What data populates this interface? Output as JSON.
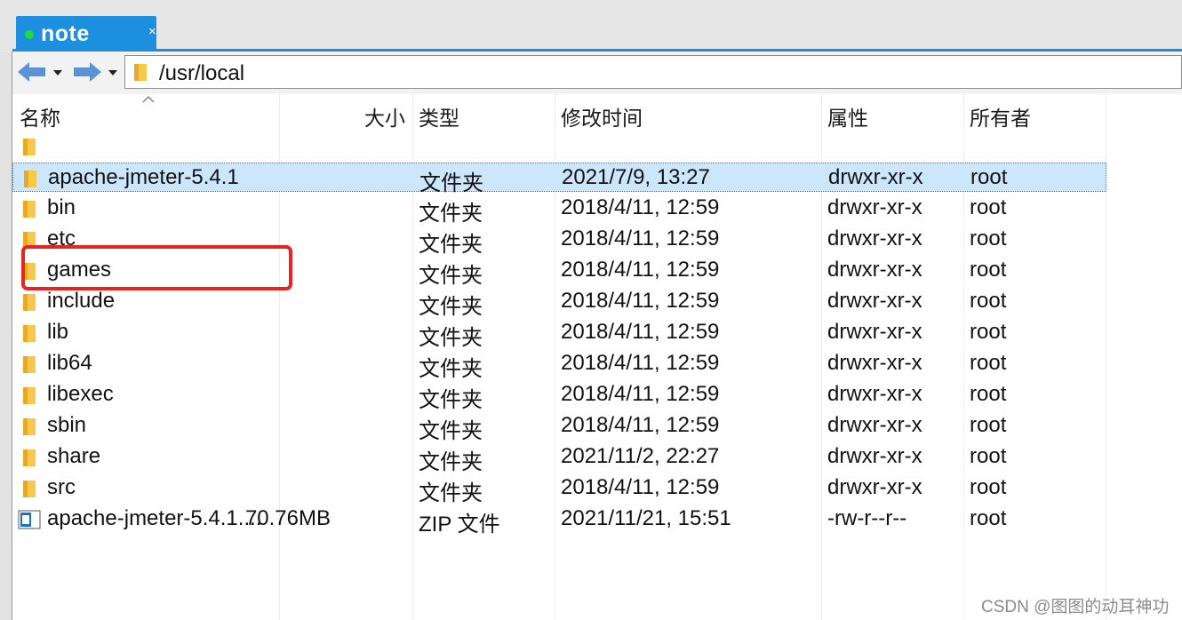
{
  "tab": {
    "title": "note",
    "close_glyph": "×",
    "status_color": "#1ddc3a",
    "accent": "#1c8fde"
  },
  "toolbar": {
    "back_icon": "arrow-left-icon",
    "forward_icon": "arrow-right-icon",
    "dropdown_icon": "caret-down-icon",
    "path": "/usr/local"
  },
  "columns": {
    "name": "名称",
    "size": "大小",
    "type": "类型",
    "modified": "修改时间",
    "attributes": "属性",
    "owner": "所有者",
    "sort_icon": "sort-ascending-icon"
  },
  "files": [
    {
      "name": "",
      "size": "",
      "type": "",
      "modified": "",
      "attributes": "",
      "owner": "",
      "icon": "folder-icon",
      "selected": false
    },
    {
      "name": "apache-jmeter-5.4.1",
      "size": "",
      "type": "文件夹",
      "modified": "2021/7/9, 13:27",
      "attributes": "drwxr-xr-x",
      "owner": "root",
      "icon": "folder-icon",
      "selected": true
    },
    {
      "name": "bin",
      "size": "",
      "type": "文件夹",
      "modified": "2018/4/11, 12:59",
      "attributes": "drwxr-xr-x",
      "owner": "root",
      "icon": "folder-icon",
      "selected": false
    },
    {
      "name": "etc",
      "size": "",
      "type": "文件夹",
      "modified": "2018/4/11, 12:59",
      "attributes": "drwxr-xr-x",
      "owner": "root",
      "icon": "folder-icon",
      "selected": false
    },
    {
      "name": "games",
      "size": "",
      "type": "文件夹",
      "modified": "2018/4/11, 12:59",
      "attributes": "drwxr-xr-x",
      "owner": "root",
      "icon": "folder-icon",
      "selected": false
    },
    {
      "name": "include",
      "size": "",
      "type": "文件夹",
      "modified": "2018/4/11, 12:59",
      "attributes": "drwxr-xr-x",
      "owner": "root",
      "icon": "folder-icon",
      "selected": false
    },
    {
      "name": "lib",
      "size": "",
      "type": "文件夹",
      "modified": "2018/4/11, 12:59",
      "attributes": "drwxr-xr-x",
      "owner": "root",
      "icon": "folder-icon",
      "selected": false
    },
    {
      "name": "lib64",
      "size": "",
      "type": "文件夹",
      "modified": "2018/4/11, 12:59",
      "attributes": "drwxr-xr-x",
      "owner": "root",
      "icon": "folder-icon",
      "selected": false
    },
    {
      "name": "libexec",
      "size": "",
      "type": "文件夹",
      "modified": "2018/4/11, 12:59",
      "attributes": "drwxr-xr-x",
      "owner": "root",
      "icon": "folder-icon",
      "selected": false
    },
    {
      "name": "sbin",
      "size": "",
      "type": "文件夹",
      "modified": "2018/4/11, 12:59",
      "attributes": "drwxr-xr-x",
      "owner": "root",
      "icon": "folder-icon",
      "selected": false
    },
    {
      "name": "share",
      "size": "",
      "type": "文件夹",
      "modified": "2021/11/2, 22:27",
      "attributes": "drwxr-xr-x",
      "owner": "root",
      "icon": "folder-icon",
      "selected": false
    },
    {
      "name": "src",
      "size": "",
      "type": "文件夹",
      "modified": "2018/4/11, 12:59",
      "attributes": "drwxr-xr-x",
      "owner": "root",
      "icon": "folder-icon",
      "selected": false
    },
    {
      "name": "apache-jmeter-5.4.1....",
      "size": "70.76MB",
      "type": "ZIP 文件",
      "modified": "2021/11/21, 15:51",
      "attributes": "-rw-r--r--",
      "owner": "root",
      "icon": "zip-file-icon",
      "selected": false
    }
  ],
  "colors": {
    "selection": "#cce6fb",
    "highlight_box": "#e62424",
    "folder": "#f7c84a"
  },
  "watermark": "CSDN @图图的动耳神功"
}
